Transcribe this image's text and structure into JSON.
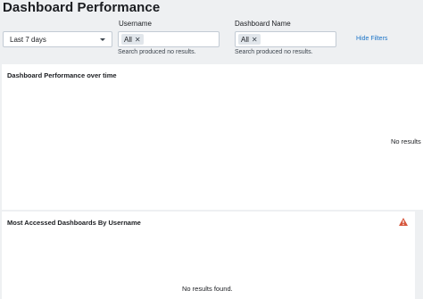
{
  "page": {
    "title": "Dashboard Performance"
  },
  "filters": {
    "time_range": {
      "value": "Last 7 days"
    },
    "username": {
      "label": "Username",
      "token": "All",
      "remove_glyph": "✕",
      "help_text": "Search produced no results."
    },
    "dashboard_name": {
      "label": "Dashboard Name",
      "token": "All",
      "remove_glyph": "✕",
      "help_text": "Search produced no results."
    },
    "hide_filters_label": "Hide Filters"
  },
  "panels": {
    "performance": {
      "title": "Dashboard Performance over time",
      "message": "No results f"
    },
    "most_accessed": {
      "title": "Most Accessed Dashboards By Username",
      "message": "No results found.",
      "warning_icon": "warning-icon",
      "warning_color": "#d6563c"
    }
  }
}
